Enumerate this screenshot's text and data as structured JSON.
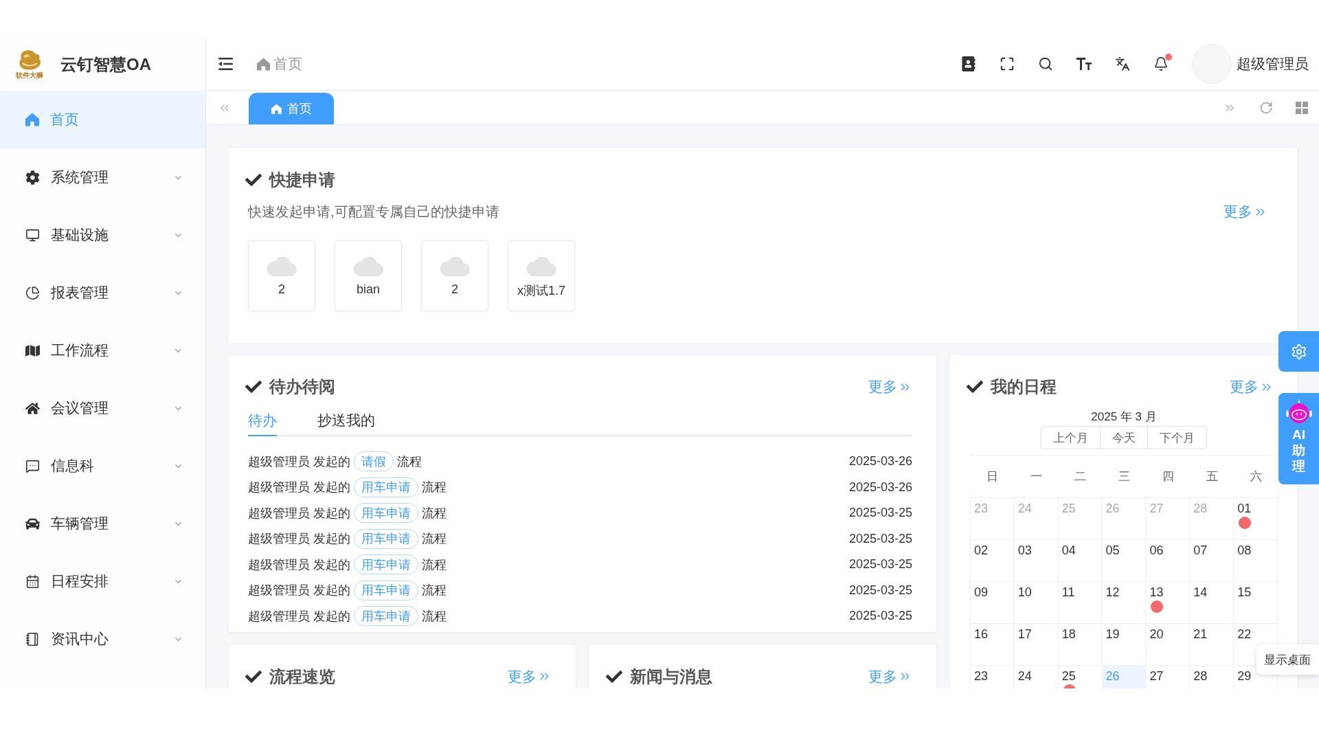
{
  "sidebar": {
    "brand": {
      "logo_caption": "软件大狮",
      "title": "云钉智慧OA"
    },
    "items": [
      {
        "label": "首页",
        "kind": "link",
        "selected": true
      },
      {
        "label": "系统管理",
        "kind": "menu",
        "selected": false,
        "expanded": false
      },
      {
        "label": "基础设施",
        "kind": "menu",
        "selected": false,
        "expanded": false
      },
      {
        "label": "报表管理",
        "kind": "menu",
        "selected": false,
        "expanded": false
      },
      {
        "label": "工作流程",
        "kind": "menu",
        "selected": false,
        "expanded": false
      },
      {
        "label": "会议管理",
        "kind": "menu",
        "selected": false,
        "expanded": false
      },
      {
        "label": "信息科",
        "kind": "menu",
        "selected": false,
        "expanded": false
      },
      {
        "label": "车辆管理",
        "kind": "menu",
        "selected": false,
        "expanded": false
      },
      {
        "label": "日程安排",
        "kind": "menu",
        "selected": false,
        "expanded": false
      },
      {
        "label": "资讯中心",
        "kind": "menu",
        "selected": false,
        "expanded": false
      }
    ]
  },
  "header": {
    "breadcrumb": [
      {
        "label": "首页"
      }
    ],
    "unread_notifications": true,
    "user_name": "超级管理员"
  },
  "tabs": [
    {
      "label": "首页",
      "selected": true
    }
  ],
  "quick_apply": {
    "title": "快捷申请",
    "description": "快速发起申请,可配置专属自己的快捷申请",
    "more": "更多",
    "items": [
      {
        "label": "2"
      },
      {
        "label": "bian"
      },
      {
        "label": "2"
      },
      {
        "label": "x测试1.7"
      }
    ]
  },
  "todo": {
    "title": "待办待阅",
    "more": "更多",
    "tabs": [
      {
        "label": "待办",
        "selected": true
      },
      {
        "label": "抄送我的",
        "selected": false
      }
    ],
    "rows": [
      {
        "initiator": "超级管理员 发起的",
        "tag": "请假",
        "suffix": "流程",
        "date": "2025-03-26"
      },
      {
        "initiator": "超级管理员 发起的",
        "tag": "用车申请",
        "suffix": "流程",
        "date": "2025-03-26"
      },
      {
        "initiator": "超级管理员 发起的",
        "tag": "用车申请",
        "suffix": "流程",
        "date": "2025-03-25"
      },
      {
        "initiator": "超级管理员 发起的",
        "tag": "用车申请",
        "suffix": "流程",
        "date": "2025-03-25"
      },
      {
        "initiator": "超级管理员 发起的",
        "tag": "用车申请",
        "suffix": "流程",
        "date": "2025-03-25"
      },
      {
        "initiator": "超级管理员 发起的",
        "tag": "用车申请",
        "suffix": "流程",
        "date": "2025-03-25"
      },
      {
        "initiator": "超级管理员 发起的",
        "tag": "用车申请",
        "suffix": "流程",
        "date": "2025-03-25"
      }
    ]
  },
  "schedule": {
    "title": "我的日程",
    "more": "更多",
    "month": "2025 年 3 月",
    "buttons": [
      "上个月",
      "今天",
      "下个月"
    ],
    "weekdays": [
      "日",
      "一",
      "二",
      "三",
      "四",
      "五",
      "六"
    ],
    "days": [
      {
        "day": "23",
        "outside": true,
        "event": false,
        "today": false
      },
      {
        "day": "24",
        "outside": true,
        "event": false,
        "today": false
      },
      {
        "day": "25",
        "outside": true,
        "event": false,
        "today": false
      },
      {
        "day": "26",
        "outside": true,
        "event": false,
        "today": false
      },
      {
        "day": "27",
        "outside": true,
        "event": false,
        "today": false
      },
      {
        "day": "28",
        "outside": true,
        "event": false,
        "today": false
      },
      {
        "day": "01",
        "outside": false,
        "event": true,
        "today": false
      },
      {
        "day": "02",
        "outside": false,
        "event": false,
        "today": false
      },
      {
        "day": "03",
        "outside": false,
        "event": false,
        "today": false
      },
      {
        "day": "04",
        "outside": false,
        "event": false,
        "today": false
      },
      {
        "day": "05",
        "outside": false,
        "event": false,
        "today": false
      },
      {
        "day": "06",
        "outside": false,
        "event": false,
        "today": false
      },
      {
        "day": "07",
        "outside": false,
        "event": false,
        "today": false
      },
      {
        "day": "08",
        "outside": false,
        "event": false,
        "today": false
      },
      {
        "day": "09",
        "outside": false,
        "event": false,
        "today": false
      },
      {
        "day": "10",
        "outside": false,
        "event": false,
        "today": false
      },
      {
        "day": "11",
        "outside": false,
        "event": false,
        "today": false
      },
      {
        "day": "12",
        "outside": false,
        "event": false,
        "today": false
      },
      {
        "day": "13",
        "outside": false,
        "event": true,
        "today": false
      },
      {
        "day": "14",
        "outside": false,
        "event": false,
        "today": false
      },
      {
        "day": "15",
        "outside": false,
        "event": false,
        "today": false
      },
      {
        "day": "16",
        "outside": false,
        "event": false,
        "today": false
      },
      {
        "day": "17",
        "outside": false,
        "event": false,
        "today": false
      },
      {
        "day": "18",
        "outside": false,
        "event": false,
        "today": false
      },
      {
        "day": "19",
        "outside": false,
        "event": false,
        "today": false
      },
      {
        "day": "20",
        "outside": false,
        "event": false,
        "today": false
      },
      {
        "day": "21",
        "outside": false,
        "event": false,
        "today": false
      },
      {
        "day": "22",
        "outside": false,
        "event": false,
        "today": false
      },
      {
        "day": "23",
        "outside": false,
        "event": false,
        "today": false
      },
      {
        "day": "24",
        "outside": false,
        "event": false,
        "today": false
      },
      {
        "day": "25",
        "outside": false,
        "event": true,
        "today": false
      },
      {
        "day": "26",
        "outside": false,
        "event": false,
        "today": true
      },
      {
        "day": "27",
        "outside": false,
        "event": false,
        "today": false
      },
      {
        "day": "28",
        "outside": false,
        "event": false,
        "today": false
      },
      {
        "day": "29",
        "outside": false,
        "event": false,
        "today": false
      }
    ]
  },
  "process_overview": {
    "title": "流程速览",
    "more": "更多"
  },
  "news": {
    "title": "新闻与消息",
    "more": "更多"
  },
  "assistant": {
    "label": "AI助理"
  },
  "desktop_tooltip": "显示桌面"
}
